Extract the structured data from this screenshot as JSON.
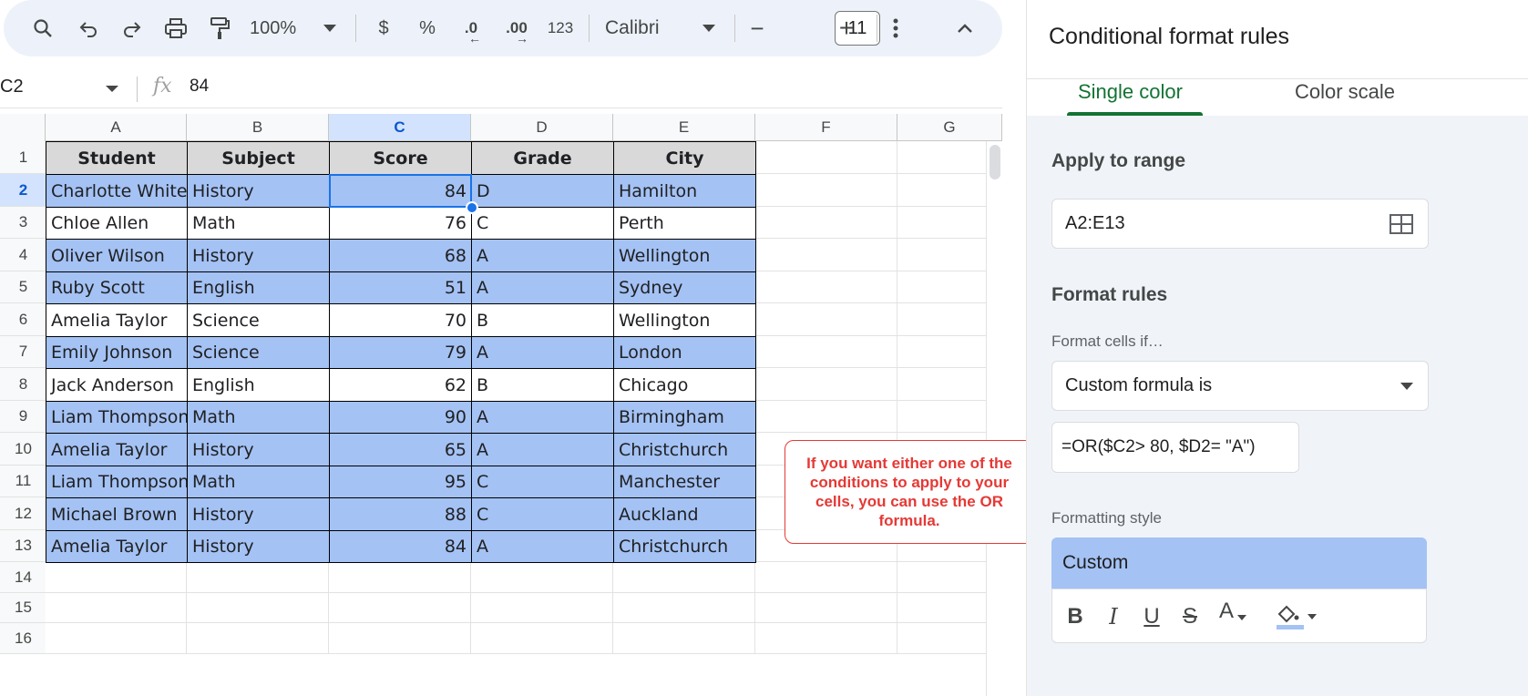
{
  "toolbar": {
    "zoom": "100%",
    "currency": "$",
    "percent": "%",
    "decrease_decimal": ".0",
    "increase_decimal": ".00",
    "number_format": "123",
    "font": "Calibri",
    "font_size": "11",
    "minus": "−",
    "plus": "+"
  },
  "formula_bar": {
    "cell_ref": "C2",
    "fx": "fx",
    "value": "84"
  },
  "grid": {
    "columns": [
      "A",
      "B",
      "C",
      "D",
      "E",
      "F",
      "G"
    ],
    "rows": [
      "1",
      "2",
      "3",
      "4",
      "5",
      "6",
      "7",
      "8",
      "9",
      "10",
      "11",
      "12",
      "13",
      "14",
      "15",
      "16"
    ],
    "headers": [
      "Student",
      "Subject",
      "Score",
      "Grade",
      "City"
    ],
    "data": [
      [
        "Charlotte White",
        "History",
        "84",
        "D",
        "Hamilton"
      ],
      [
        "Chloe Allen",
        "Math",
        "76",
        "C",
        "Perth"
      ],
      [
        "Oliver Wilson",
        "History",
        "68",
        "A",
        "Wellington"
      ],
      [
        "Ruby Scott",
        "English",
        "51",
        "A",
        "Sydney"
      ],
      [
        "Amelia Taylor",
        "Science",
        "70",
        "B",
        "Wellington"
      ],
      [
        "Emily Johnson",
        "Science",
        "79",
        "A",
        "London"
      ],
      [
        "Jack Anderson",
        "English",
        "62",
        "B",
        "Chicago"
      ],
      [
        "Liam Thompson",
        "Math",
        "90",
        "A",
        "Birmingham"
      ],
      [
        "Amelia Taylor",
        "History",
        "65",
        "A",
        "Christchurch"
      ],
      [
        "Liam Thompson",
        "Math",
        "95",
        "C",
        "Manchester"
      ],
      [
        "Michael Brown",
        "History",
        "88",
        "C",
        "Auckland"
      ],
      [
        "Amelia Taylor",
        "History",
        "84",
        "A",
        "Christchurch"
      ]
    ],
    "highlighted": [
      true,
      false,
      true,
      true,
      false,
      true,
      false,
      true,
      true,
      true,
      true,
      true
    ],
    "selected_column": "C",
    "selected_row": "2"
  },
  "callout": {
    "text": "If you want either one of the conditions to apply to your cells, you can use the OR formula."
  },
  "panel": {
    "title": "Conditional format rules",
    "tabs": [
      "Single color",
      "Color scale"
    ],
    "apply_range_title": "Apply to range",
    "range": "A2:E13",
    "format_rules_title": "Format rules",
    "format_cells_if": "Format cells if…",
    "condition": "Custom formula is",
    "formula": "=OR($C2> 80, $D2= \"A\")",
    "formatting_style_label": "Formatting style",
    "style_name": "Custom",
    "style_buttons": [
      "B",
      "I",
      "U",
      "S",
      "A"
    ]
  },
  "colors": {
    "highlight": "#a4c2f4",
    "header_fill": "#d9d9d9",
    "accent_green": "#137333",
    "callout_red": "#e53935",
    "selection_blue": "#1a73e8"
  }
}
